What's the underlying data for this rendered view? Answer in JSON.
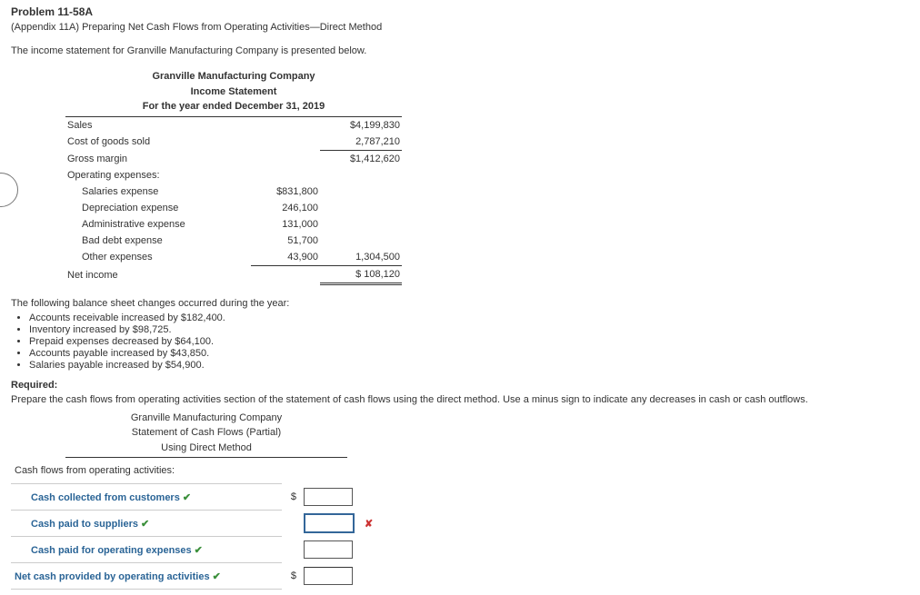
{
  "header": {
    "problem": "Problem 11-58A",
    "subtitle": "(Appendix 11A) Preparing Net Cash Flows from Operating Activities—Direct Method",
    "intro": "The income statement for Granville Manufacturing Company is presented below."
  },
  "income_statement": {
    "company": "Granville Manufacturing Company",
    "title": "Income Statement",
    "period": "For the year ended December 31, 2019",
    "lines": {
      "sales_label": "Sales",
      "sales": "$4,199,830",
      "cogs_label": "Cost of goods sold",
      "cogs": "2,787,210",
      "gross_label": "Gross margin",
      "gross": "$1,412,620",
      "opexp_label": "Operating expenses:",
      "salaries_label": "Salaries expense",
      "salaries": "$831,800",
      "dep_label": "Depreciation expense",
      "dep": "246,100",
      "admin_label": "Administrative expense",
      "admin": "131,000",
      "bad_label": "Bad debt expense",
      "bad": "51,700",
      "other_label": "Other expenses",
      "other": "43,900",
      "total_opexp": "1,304,500",
      "netinc_label": "Net income",
      "netinc": "$ 108,120"
    }
  },
  "changes_intro": "The following balance sheet changes occurred during the year:",
  "changes": [
    "Accounts receivable increased by $182,400.",
    "Inventory increased by $98,725.",
    "Prepaid expenses decreased by $64,100.",
    "Accounts payable increased by $43,850.",
    "Salaries payable increased by $54,900."
  ],
  "required_label": "Required:",
  "required_text": "Prepare the cash flows from operating activities section of the statement of cash flows using the direct method. Use a minus sign to indicate any decreases in cash or cash outflows.",
  "answer": {
    "company": "Granville Manufacturing Company",
    "title": "Statement of Cash Flows (Partial)",
    "method": "Using Direct Method",
    "section": "Cash flows from operating activities:",
    "rows": {
      "r1": "Cash collected from customers",
      "r2": "Cash paid to suppliers",
      "r3": "Cash paid for operating expenses",
      "r4": "Net cash provided by operating activities"
    },
    "marks": {
      "check": "✔",
      "x": "✘"
    },
    "dollar": "$"
  }
}
